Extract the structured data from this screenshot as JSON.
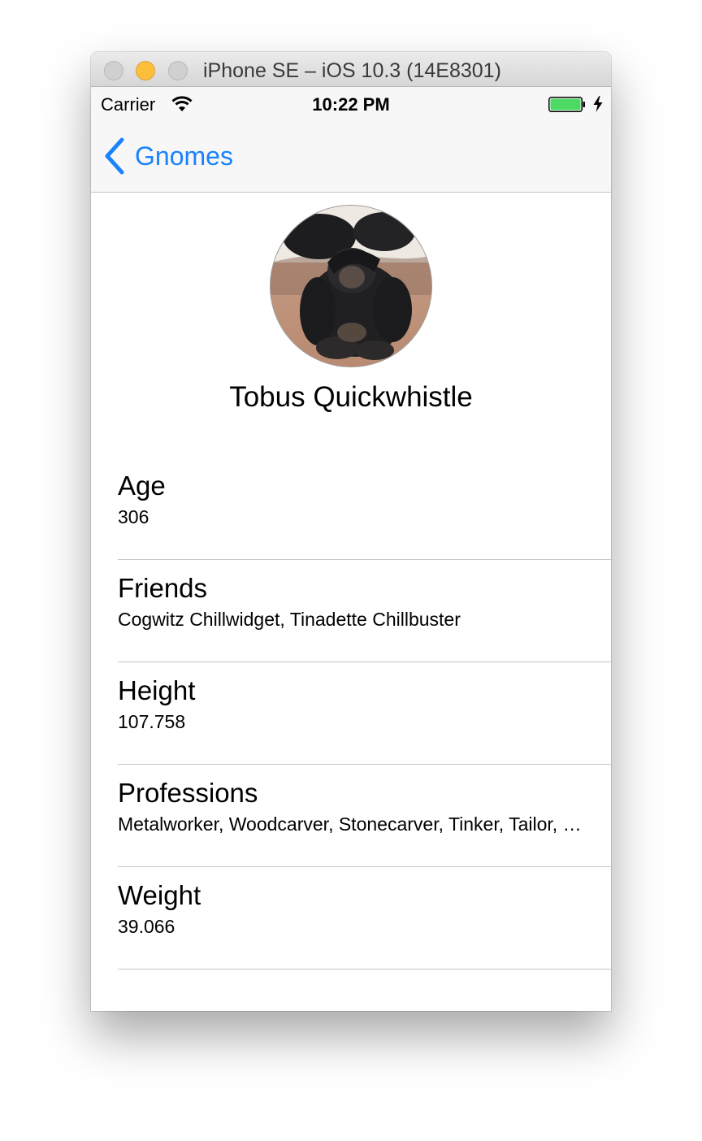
{
  "window": {
    "title": "iPhone SE – iOS 10.3 (14E8301)"
  },
  "status_bar": {
    "carrier": "Carrier",
    "time": "10:22 PM",
    "battery_color": "#4cd964",
    "charging": true
  },
  "nav": {
    "back_label": "Gnomes",
    "tint_color": "#1a82fb"
  },
  "profile": {
    "name": "Tobus Quickwhistle",
    "avatar": "chimpanzee-photo"
  },
  "details": [
    {
      "title": "Age",
      "value": "306"
    },
    {
      "title": "Friends",
      "value": "Cogwitz Chillwidget, Tinadette Chillbuster"
    },
    {
      "title": "Height",
      "value": "107.758"
    },
    {
      "title": "Professions",
      "value": "Metalworker, Woodcarver, Stonecarver,  Tinker, Tailor, Potter"
    },
    {
      "title": "Weight",
      "value": "39.066"
    }
  ]
}
